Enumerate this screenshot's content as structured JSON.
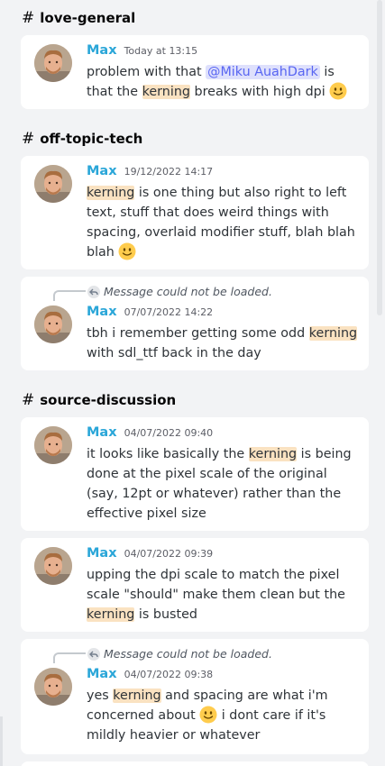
{
  "channels": [
    {
      "name": "love-general",
      "messages": [
        {
          "author": "Max",
          "time": "Today at 13:15",
          "reply_unavailable": false,
          "segments": [
            {
              "t": "problem with that "
            },
            {
              "t": "@Miku AuahDark",
              "mention": true
            },
            {
              "t": " is that the "
            },
            {
              "t": "kerning",
              "hl": true
            },
            {
              "t": " breaks with high dpi "
            },
            {
              "emoji": "slight-smile"
            }
          ]
        }
      ]
    },
    {
      "name": "off-topic-tech",
      "messages": [
        {
          "author": "Max",
          "time": "19/12/2022 14:17",
          "reply_unavailable": false,
          "segments": [
            {
              "t": "kerning",
              "hl": true
            },
            {
              "t": " is one thing but also right to left text, stuff that does weird things with spacing, overlaid modifier stuff, blah blah blah "
            },
            {
              "emoji": "slight-smile"
            }
          ]
        },
        {
          "author": "Max",
          "time": "07/07/2022 14:22",
          "reply_unavailable": true,
          "segments": [
            {
              "t": "tbh i remember getting some odd "
            },
            {
              "t": "kerning",
              "hl": true
            },
            {
              "t": " with sdl_ttf back in the day"
            }
          ]
        }
      ]
    },
    {
      "name": "source-discussion",
      "messages": [
        {
          "author": "Max",
          "time": "04/07/2022 09:40",
          "reply_unavailable": false,
          "segments": [
            {
              "t": "it looks like basically the "
            },
            {
              "t": "kerning",
              "hl": true
            },
            {
              "t": " is being done at the pixel scale of the original (say, 12pt or whatever) rather than the effective pixel size"
            }
          ]
        },
        {
          "author": "Max",
          "time": "04/07/2022 09:39",
          "reply_unavailable": false,
          "segments": [
            {
              "t": "upping the dpi scale to match the pixel scale \"should\" make them clean but the "
            },
            {
              "t": "kerning",
              "hl": true
            },
            {
              "t": " is busted"
            }
          ]
        },
        {
          "author": "Max",
          "time": "04/07/2022 09:38",
          "reply_unavailable": true,
          "segments": [
            {
              "t": "yes "
            },
            {
              "t": "kerning",
              "hl": true
            },
            {
              "t": " and spacing are what i'm concerned about "
            },
            {
              "emoji": "slight-smile"
            },
            {
              "t": " i dont care if it's mildly heavier or whatever"
            }
          ]
        }
      ]
    }
  ],
  "reply_unavailable_text": "Message could not be loaded.",
  "colors": {
    "author": "#2aa6d8",
    "highlight": "#fae2c1",
    "mention_bg": "#dee0fc",
    "mention_fg": "#5865f2",
    "page_bg": "#f2f3f5",
    "card_bg": "#ffffff"
  }
}
